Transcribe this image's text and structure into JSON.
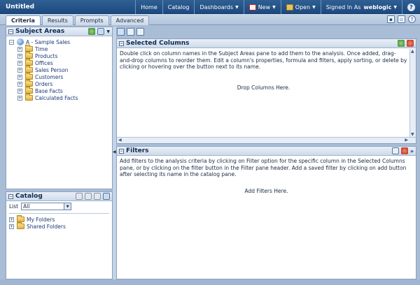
{
  "window": {
    "title": "Untitled"
  },
  "nav": {
    "home": "Home",
    "catalog": "Catalog",
    "dashboards": "Dashboards",
    "new": "New",
    "open": "Open",
    "signed_in_as": "Signed In As",
    "user": "weblogic",
    "help": "?"
  },
  "tabs": [
    {
      "label": "Criteria",
      "active": true
    },
    {
      "label": "Results"
    },
    {
      "label": "Prompts"
    },
    {
      "label": "Advanced"
    }
  ],
  "subject_areas": {
    "title": "Subject Areas",
    "root": "A - Sample Sales",
    "items": [
      "Time",
      "Products",
      "Offices",
      "Sales Person",
      "Customers",
      "Orders",
      "Base Facts",
      "Calculated Facts"
    ]
  },
  "catalog": {
    "title": "Catalog",
    "list_label": "List",
    "list_value": "All",
    "items": [
      "My Folders",
      "Shared Folders"
    ]
  },
  "selected_columns": {
    "title": "Selected Columns",
    "help_text": "Double click on column names in the Subject Areas pane to add them to the analysis. Once added, drag-and-drop columns to reorder them. Edit a column's properties, formula and filters, apply sorting, or delete by clicking or hovering over the button next to its name.",
    "drop_text": "Drop Columns Here."
  },
  "filters": {
    "title": "Filters",
    "help_text": "Add filters to the analysis criteria by clicking on Filter option for the specific column in the Selected Columns pane, or by clicking on the filter button in the Filter pane header. Add a saved filter by clicking on add button after selecting its name in the catalog pane.",
    "drop_text": "Add Filters Here."
  },
  "colors": {
    "topbar": "#1d4a7e",
    "background": "#a9bdd6",
    "link": "#1a3a78"
  }
}
